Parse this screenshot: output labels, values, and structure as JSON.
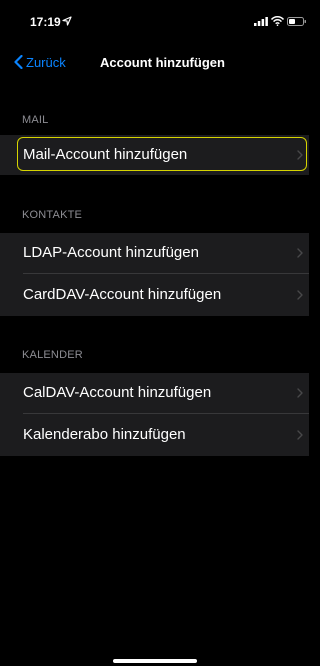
{
  "status_bar": {
    "time": "17:19"
  },
  "nav": {
    "back_label": "Zurück",
    "title": "Account hinzufügen"
  },
  "sections": [
    {
      "header": "MAIL",
      "items": [
        {
          "label": "Mail-Account hinzufügen"
        }
      ]
    },
    {
      "header": "KONTAKTE",
      "items": [
        {
          "label": "LDAP-Account hinzufügen"
        },
        {
          "label": "CardDAV-Account hinzufügen"
        }
      ]
    },
    {
      "header": "KALENDER",
      "items": [
        {
          "label": "CalDAV-Account hinzufügen"
        },
        {
          "label": "Kalenderabo hinzufügen"
        }
      ]
    }
  ],
  "colors": {
    "background": "#000000",
    "cell_background": "#1c1c1e",
    "accent": "#0a84ff",
    "focus_ring": "#d6d400",
    "secondary_text": "#8d8d93"
  }
}
